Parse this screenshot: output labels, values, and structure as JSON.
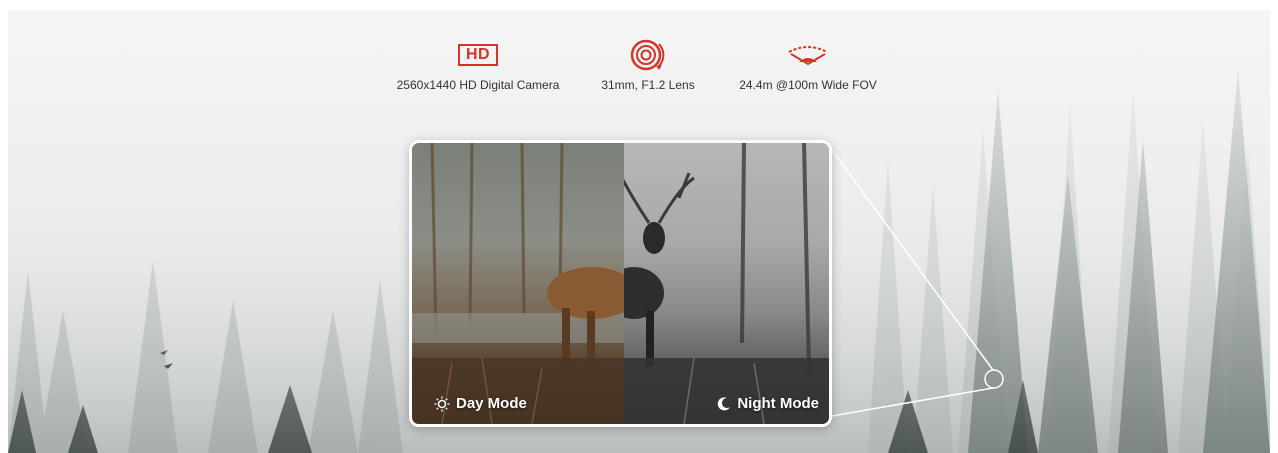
{
  "features": [
    {
      "icon": "hd-icon",
      "label": "2560x1440 HD Digital Camera",
      "badge": "HD"
    },
    {
      "icon": "lens-icon",
      "label": "31mm, F1.2 Lens"
    },
    {
      "icon": "wide-fov-eye-icon",
      "label": "24.4m @100m Wide FOV"
    }
  ],
  "modes": {
    "day": {
      "label": "Day Mode",
      "icon": "sun-icon"
    },
    "night": {
      "label": "Night Mode",
      "icon": "moon-icon"
    }
  },
  "colors": {
    "accent_red": "#d9322b",
    "label_text": "#333333",
    "mode_text": "#ffffff"
  }
}
